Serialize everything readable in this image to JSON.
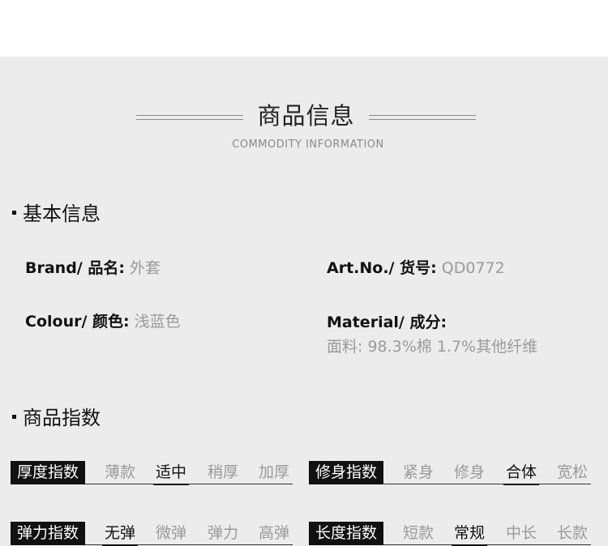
{
  "header": {
    "title": "商品信息",
    "subtitle": "COMMODITY INFORMATION"
  },
  "basic_info": {
    "heading": "基本信息",
    "brand": {
      "label": "Brand/ 品名:",
      "value": "外套"
    },
    "art_no": {
      "label": "Art.No./ 货号:",
      "value": "QD0772"
    },
    "colour": {
      "label": "Colour/ 颜色:",
      "value": "浅蓝色"
    },
    "material": {
      "label": "Material/ 成分:",
      "value": "面料: 98.3%棉 1.7%其他纤维"
    }
  },
  "indices": {
    "heading": "商品指数",
    "thickness": {
      "label": "厚度指数",
      "options": [
        "薄款",
        "适中",
        "稍厚",
        "加厚"
      ],
      "selected": "适中"
    },
    "fit": {
      "label": "修身指数",
      "options": [
        "紧身",
        "修身",
        "合体",
        "宽松"
      ],
      "selected": "合体"
    },
    "elasticity": {
      "label": "弹力指数",
      "options": [
        "无弹",
        "微弹",
        "弹力",
        "高弹"
      ],
      "selected": "无弹"
    },
    "length": {
      "label": "长度指数",
      "options": [
        "短款",
        "常规",
        "中长",
        "长款"
      ],
      "selected": "常规"
    }
  }
}
